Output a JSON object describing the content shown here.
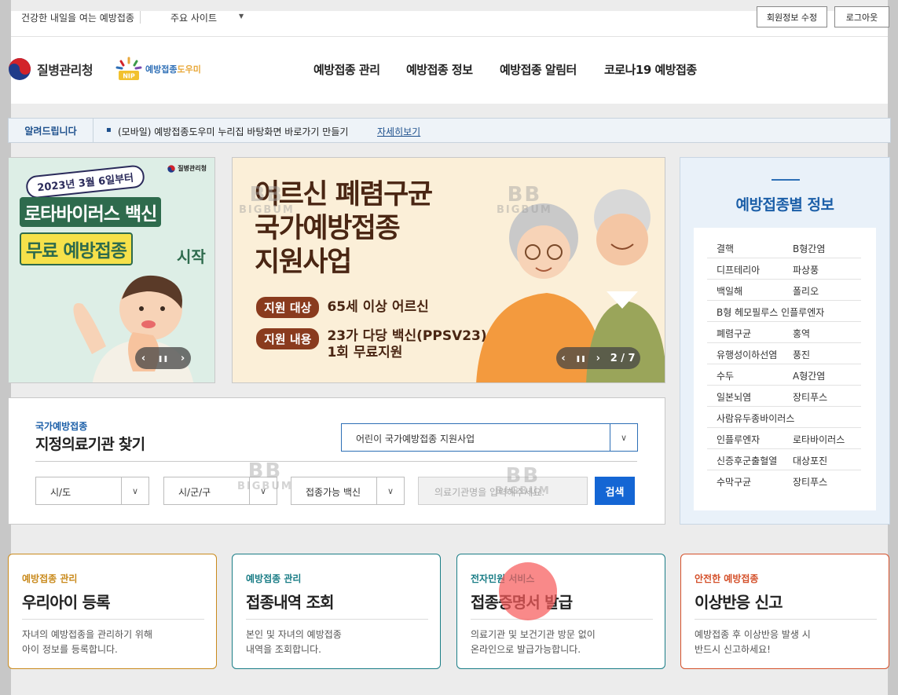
{
  "util": {
    "tagline": "건강한 내일을 여는 예방접종",
    "sites_label": "주요 사이트",
    "sites_arrow": "▼",
    "edit_profile": "회원정보 수정",
    "logout": "로그아웃"
  },
  "header": {
    "kdca_name": "질병관리청",
    "nip_name_a": "예방접종",
    "nip_name_b": "도우미",
    "nip_badge": "NIP",
    "nav": [
      "예방접종 관리",
      "예방접종 정보",
      "예방접종 알림터",
      "코로나19 예방접종"
    ]
  },
  "notice": {
    "label": "알려드립니다",
    "text": "(모바일) 예방접종도우미 누리집 바탕화면 바로가기 만들기",
    "link": "자세히보기"
  },
  "banner_left": {
    "kdca": "질병관리청",
    "date": "2023년 3월 6일부터",
    "line1": "로타바이러스 백신",
    "line2": "무료 예방접종",
    "line2b": "시작"
  },
  "banner_main": {
    "title1": "어르신 폐렴구균",
    "title2": "국가예방접종",
    "title3": "지원사업",
    "chip1": "지원 대상",
    "val1": "65세 이상 어르신",
    "chip2": "지원 내용",
    "val2a": "23가 다당 백신(PPSV23),",
    "val2b": "1회 무료지원",
    "pager": "2 / 7"
  },
  "controls": {
    "prev": "‹",
    "pause": "❚❚",
    "next": "›"
  },
  "watermark": {
    "big": "BB",
    "small": "BIGBUM"
  },
  "side": {
    "title": "예방접종별 정보",
    "rows": [
      [
        "결핵",
        "B형간염"
      ],
      [
        "디프테리아",
        "파상풍"
      ],
      [
        "백일해",
        "폴리오"
      ],
      [
        "B형 헤모필루스 인플루엔자",
        ""
      ],
      [
        "폐렴구균",
        "홍역"
      ],
      [
        "유행성이하선염",
        "풍진"
      ],
      [
        "수두",
        "A형간염"
      ],
      [
        "일본뇌염",
        "장티푸스"
      ],
      [
        "사람유두종바이러스",
        ""
      ],
      [
        "인플루엔자",
        "로타바이러스"
      ],
      [
        "신증후군출혈열",
        "대상포진"
      ],
      [
        "수막구균",
        "장티푸스"
      ]
    ]
  },
  "finder": {
    "sub": "국가예방접종",
    "title": "지정의료기관 찾기",
    "program": "어린이 국가예방접종 지원사업",
    "sido": "시/도",
    "sigungu": "시/군/구",
    "vaccine": "접종가능 백신",
    "search_placeholder": "의료기관명을 입력해주세요.",
    "search_button": "검색",
    "chevron": "∨"
  },
  "cards": [
    {
      "cat": "예방접종 관리",
      "title": "우리아이 등록",
      "d1": "자녀의 예방접종을 관리하기 위해",
      "d2": "아이 정보를 등록합니다.",
      "color": "#c98a1c"
    },
    {
      "cat": "예방접종 관리",
      "title": "접종내역 조회",
      "d1": "본인 및 자녀의 예방접종",
      "d2": "내역을 조회합니다.",
      "color": "#1a7d86"
    },
    {
      "cat": "전자민원 서비스",
      "title": "접종증명서 발급",
      "d1": "의료기관 및 보건기관 방문 없이",
      "d2": "온라인으로 발급가능합니다.",
      "color": "#1a7d86"
    },
    {
      "cat": "안전한 예방접종",
      "title": "이상반응 신고",
      "d1": "예방접종 후 이상반응 발생 시",
      "d2": "반드시 신고하세요!",
      "color": "#d4502a"
    }
  ]
}
